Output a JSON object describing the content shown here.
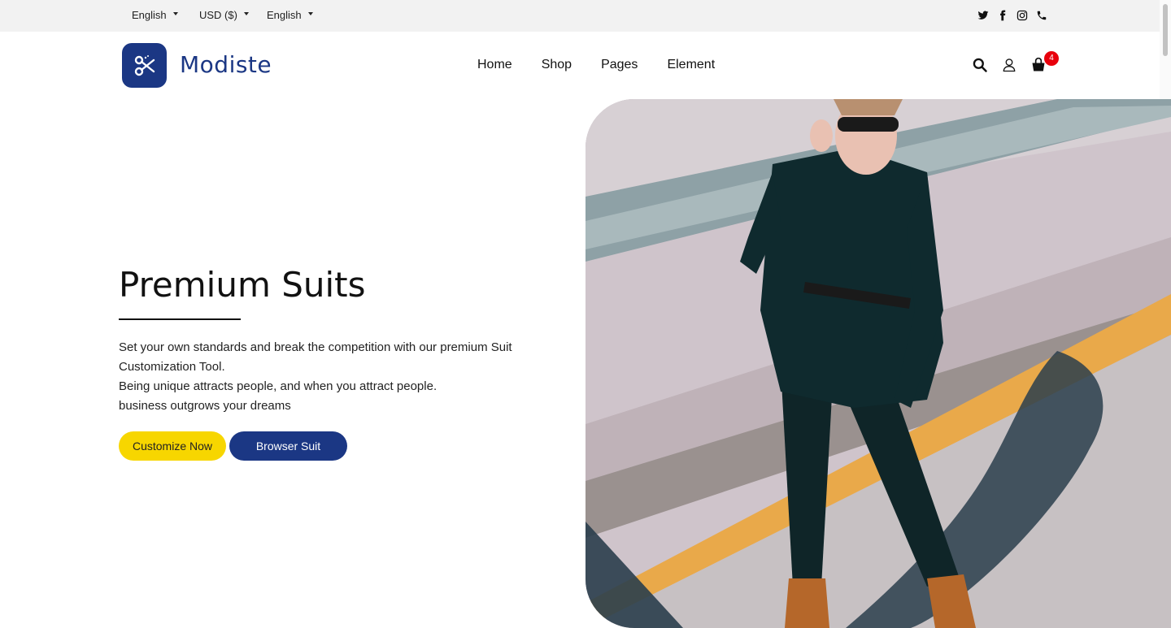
{
  "topbar": {
    "language_1": "English",
    "currency": "USD ($)",
    "language_2": "English",
    "social_icons": [
      "twitter-icon",
      "facebook-icon",
      "instagram-icon",
      "phone-icon"
    ]
  },
  "header": {
    "brand": "Modiste",
    "logo_icon": "scissors-icon",
    "nav": [
      "Home",
      "Shop",
      "Pages",
      "Element"
    ],
    "icons": [
      "search-icon",
      "user-icon",
      "cart-icon"
    ],
    "cart_count": "4"
  },
  "hero": {
    "title": "Premium Suits",
    "paragraph": [
      "Set your own standards and break the competition with our premium Suit Customization Tool.",
      "Being unique attracts people, and when you attract people.",
      "business outgrows your dreams"
    ],
    "primary_button": "Customize Now",
    "secondary_button": "Browser Suit"
  },
  "colors": {
    "brand_blue": "#1b3784",
    "accent_yellow": "#f7d600",
    "badge_red": "#e8000c",
    "topbar_bg": "#f2f2f2"
  }
}
